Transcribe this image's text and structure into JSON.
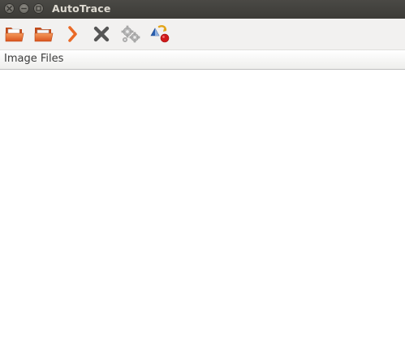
{
  "window": {
    "title": "AutoTrace",
    "controls": [
      "close-icon",
      "minimize-icon",
      "maximize-icon"
    ]
  },
  "toolbar": {
    "buttons": [
      {
        "name": "open-file-button",
        "icon": "open-folder-icon"
      },
      {
        "name": "open-folder-button",
        "icon": "open-folder-icon"
      },
      {
        "name": "run-button",
        "icon": "chevron-right-icon"
      },
      {
        "name": "remove-button",
        "icon": "x-icon"
      },
      {
        "name": "settings-button",
        "icon": "gears-icon"
      },
      {
        "name": "trace-button",
        "icon": "shapes-icon"
      }
    ]
  },
  "file_list": {
    "column_header": "Image Files",
    "rows": []
  },
  "colors": {
    "titlebar": "#3c3b37",
    "toolbar": "#f2f1f0",
    "folder_orange": "#e8672a",
    "chevron_orange": "#ea6a27",
    "remove_gray": "#555555",
    "red_dot": "#d01a1a",
    "blue_triangle": "#2a5fb0"
  }
}
